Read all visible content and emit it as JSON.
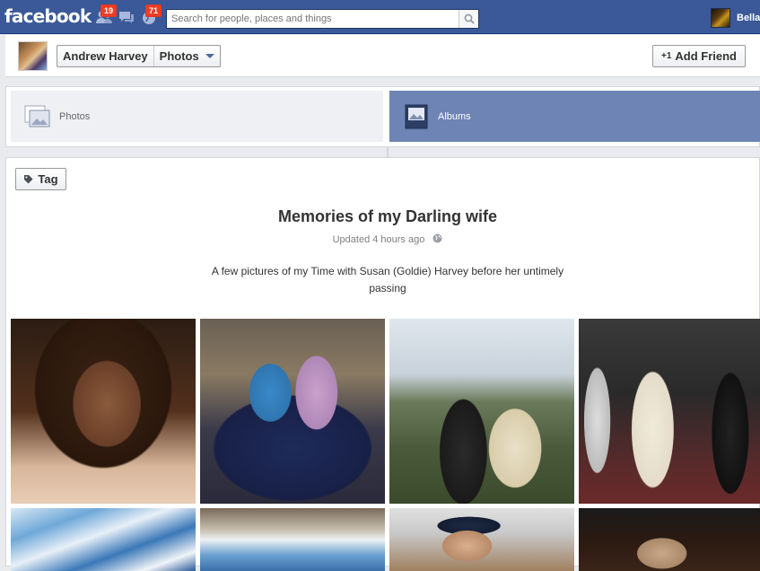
{
  "topbar": {
    "logo": "facebook",
    "friend_requests_count": "19",
    "notifications_count": "71",
    "search_placeholder": "Search for people, places and things",
    "user_name": "Bella",
    "colors": {
      "bar": "#3b5998",
      "badge": "#f03d25"
    }
  },
  "profile": {
    "name": "Andrew Harvey",
    "section": "Photos",
    "add_friend_label": "Add Friend"
  },
  "tabs": [
    {
      "label": "Photos",
      "selected": false,
      "icon": "photos-icon"
    },
    {
      "label": "Albums",
      "selected": true,
      "icon": "albums-icon"
    }
  ],
  "album": {
    "tag_label": "Tag",
    "title": "Memories of my Darling wife",
    "updated": "Updated 4 hours ago",
    "description": "A few pictures of my Time with Susan (Goldie) Harvey before her untimely passing",
    "photos": [
      {
        "subject": "portrait of woman"
      },
      {
        "subject": "two women seated on sofa"
      },
      {
        "subject": "bride and groom outdoors"
      },
      {
        "subject": "wedding ceremony indoors"
      },
      {
        "subject": "draped ceiling decoration"
      },
      {
        "subject": "decorated hall"
      },
      {
        "subject": "man in cap"
      },
      {
        "subject": "guests at dinner"
      }
    ]
  }
}
